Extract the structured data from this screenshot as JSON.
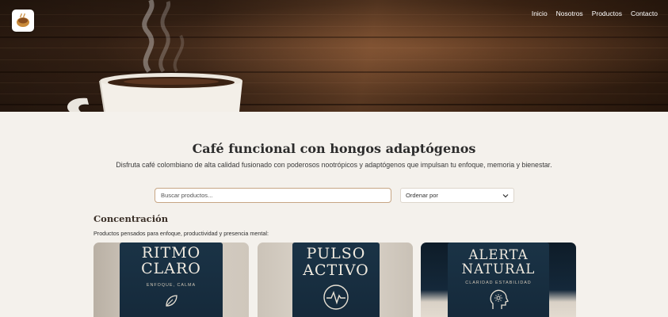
{
  "nav": {
    "items": [
      "Inicio",
      "Nosotros",
      "Productos",
      "Contacto"
    ]
  },
  "hero": {
    "logo_icon": "coffee-logo-icon"
  },
  "intro": {
    "title": "Café funcional con hongos adaptógenos",
    "subtitle": "Disfruta café colombiano de alta calidad fusionado con poderosos nootrópicos y adaptógenos que impulsan tu enfoque, memoria y bienestar."
  },
  "filters": {
    "search_placeholder": "Buscar productos...",
    "sort_label": "Ordenar por"
  },
  "section": {
    "title": "Concentración",
    "description": "Productos pensados para enfoque, productividad y presencia mental:"
  },
  "products": [
    {
      "line1": "RITMO",
      "line2": "CLARO",
      "tagline": "ENFOQUE, CALMA",
      "icon": "leaf-icon"
    },
    {
      "line1": "PULSO",
      "line2": "ACTIVO",
      "tagline": "",
      "icon": "pulse-icon"
    },
    {
      "line1": "ALERTA",
      "line2": "NATURAL",
      "tagline": "CLARIDAD  ESTABILIDAD",
      "icon": "head-icon"
    }
  ],
  "colors": {
    "accent": "#c7a684",
    "background": "#f4f1ec",
    "bag": "#1a3346"
  }
}
